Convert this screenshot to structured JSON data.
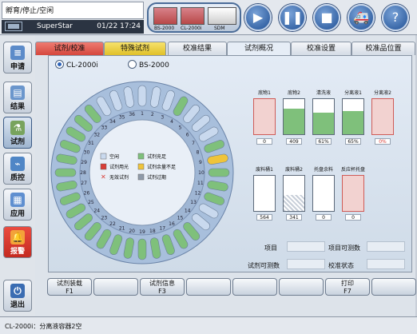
{
  "top": {
    "system_status": "孵育/停止/空闲",
    "user": "SuperStar",
    "datetime": "01/22 17:24",
    "devices": [
      "BS-2000",
      "CL-2000i",
      "SDM"
    ],
    "buttons": [
      "play-icon",
      "pause-icon",
      "stop-icon",
      "ambulance-icon",
      "help-icon"
    ]
  },
  "sidebar": [
    "申请",
    "结果",
    "试剂",
    "质控",
    "应用",
    "报警",
    "退出"
  ],
  "tabs": [
    "试剂/校准",
    "特殊试剂",
    "校准结果",
    "试剂概况",
    "校准设置",
    "校准品位置"
  ],
  "radios": [
    "CL-2000i",
    "BS-2000"
  ],
  "legend": [
    "空闲",
    "试剂充足",
    "试剂用光",
    "试剂余量不足",
    "无效试剂",
    "试剂过期"
  ],
  "colors": {
    "accent": "#2f61b0",
    "green": "#7fc07b",
    "red": "#d83d36",
    "yellow": "#efc43a",
    "blue_slot": "#c9d9ee"
  },
  "containers": [
    {
      "name": "底物1",
      "value": "0"
    },
    {
      "name": "底物2",
      "value": "409"
    },
    {
      "name": "清洗液",
      "value": "61%"
    },
    {
      "name": "分离液1",
      "value": "65%"
    },
    {
      "name": "分离液2",
      "value": "0%"
    },
    {
      "name": "废料桶1",
      "value": "564"
    },
    {
      "name": "废料桶2",
      "value": "341"
    },
    {
      "name": "托盘余料",
      "value": "0"
    },
    {
      "name": "反应杯托盘",
      "value": "0"
    }
  ],
  "info": {
    "item": "项目",
    "item_tests": "项目可测数",
    "reagent_tests": "试剂可测数",
    "cal_status": "校准状态"
  },
  "fbuttons": [
    [
      "试剂装载",
      "F1"
    ],
    [
      "",
      ""
    ],
    [
      "试剂信息",
      "F3"
    ],
    [
      "",
      ""
    ],
    [
      "",
      ""
    ],
    [
      "",
      ""
    ],
    [
      "打印",
      "F7"
    ],
    [
      "",
      ""
    ]
  ],
  "status_text": "CL-2000i：分离液容器2空"
}
